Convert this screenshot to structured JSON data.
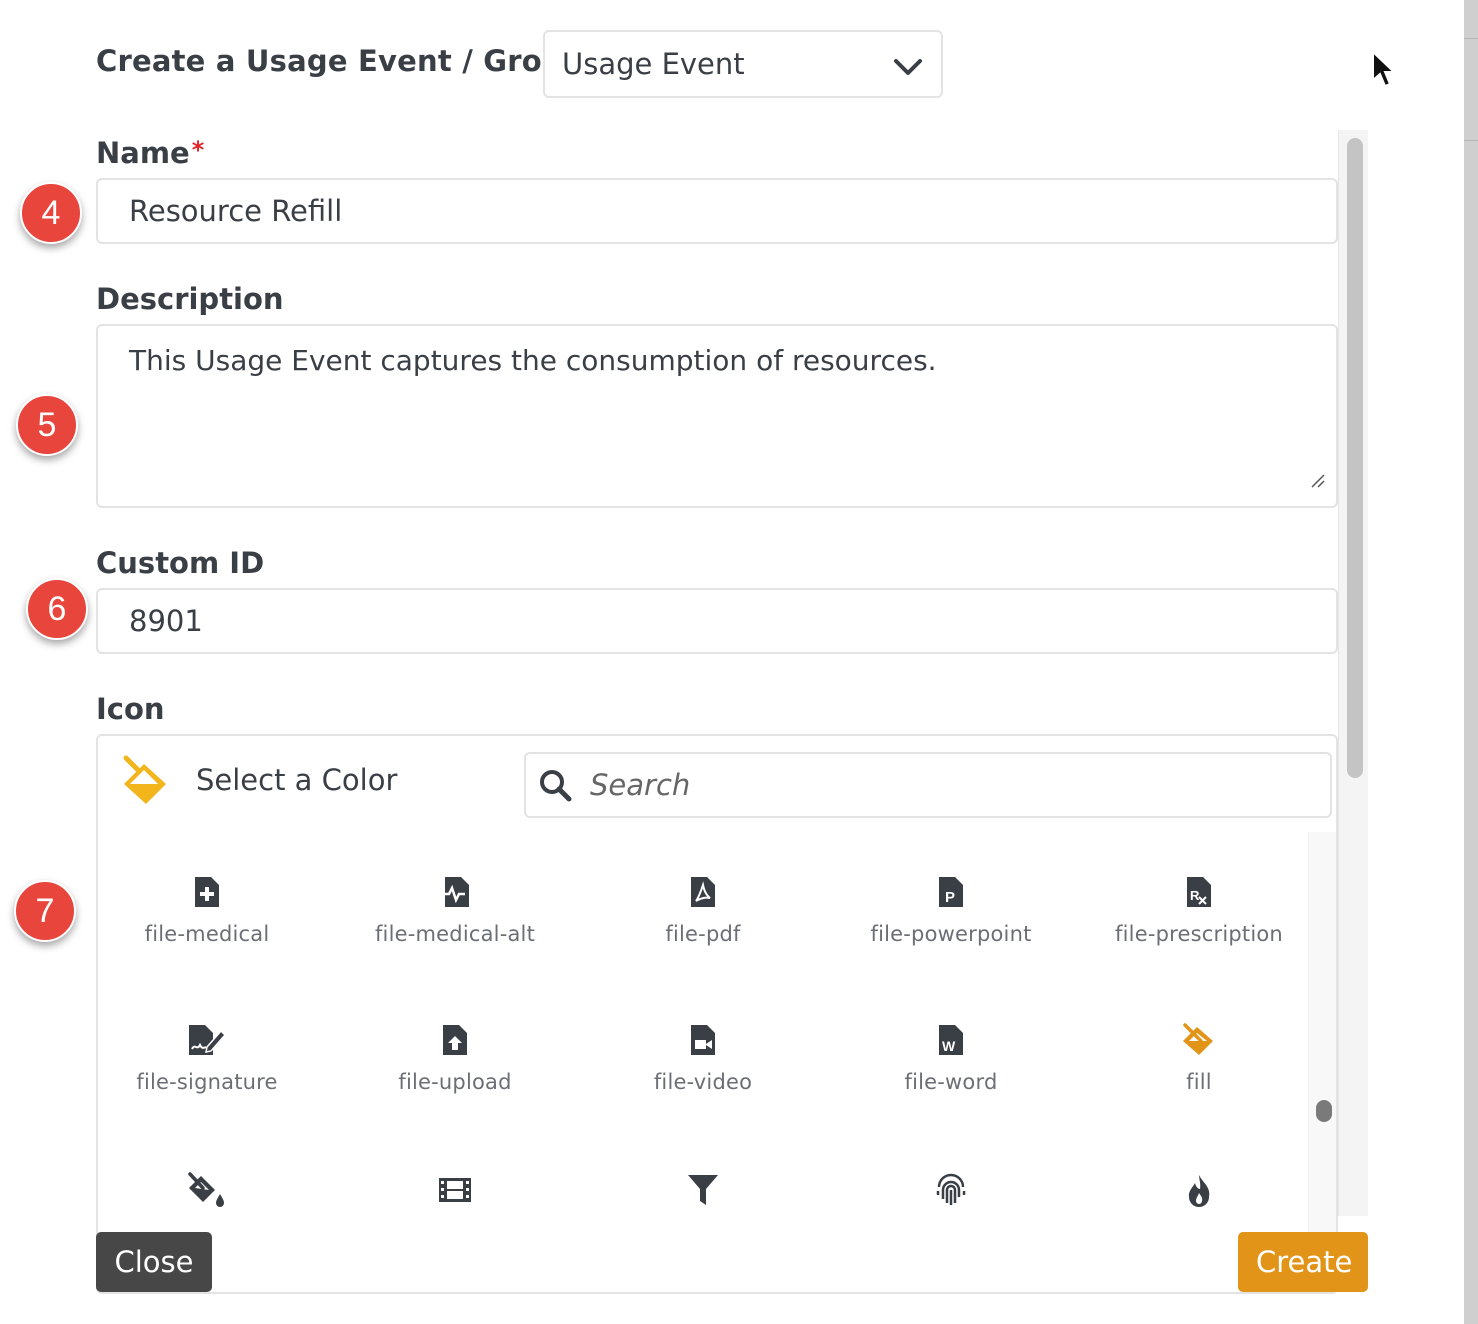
{
  "header": {
    "title": "Create a Usage Event / Group",
    "type_select": {
      "value": "Usage Event"
    }
  },
  "form": {
    "name": {
      "label": "Name",
      "required_mark": "*",
      "value": "Resource Refill"
    },
    "description": {
      "label": "Description",
      "value": "This Usage Event captures the consumption of resources."
    },
    "custom_id": {
      "label": "Custom ID",
      "value": "8901"
    },
    "icon": {
      "label": "Icon",
      "color_picker_label": "Select a Color",
      "search_placeholder": "Search",
      "items": [
        {
          "name": "file-medical",
          "icon": "file-medical-icon"
        },
        {
          "name": "file-medical-alt",
          "icon": "file-medical-alt-icon"
        },
        {
          "name": "file-pdf",
          "icon": "file-pdf-icon"
        },
        {
          "name": "file-powerpoint",
          "icon": "file-powerpoint-icon"
        },
        {
          "name": "file-prescription",
          "icon": "file-prescription-icon"
        },
        {
          "name": "file-signature",
          "icon": "file-signature-icon"
        },
        {
          "name": "file-upload",
          "icon": "file-upload-icon"
        },
        {
          "name": "file-video",
          "icon": "file-video-icon"
        },
        {
          "name": "file-word",
          "icon": "file-word-icon"
        },
        {
          "name": "fill",
          "icon": "fill-icon"
        },
        {
          "name": "",
          "icon": "fill-drip-icon"
        },
        {
          "name": "",
          "icon": "film-icon"
        },
        {
          "name": "",
          "icon": "filter-icon"
        },
        {
          "name": "",
          "icon": "fingerprint-icon"
        },
        {
          "name": "",
          "icon": "fire-icon"
        }
      ]
    }
  },
  "annotations": [
    "4",
    "5",
    "6",
    "7"
  ],
  "footer": {
    "close_label": "Close",
    "create_label": "Create"
  },
  "colors": {
    "accent": "#e29419",
    "selected_icon": "#e29419",
    "badge": "#e8453c",
    "required": "#e0262b",
    "text": "#3a3f46",
    "close_button": "#474747"
  }
}
